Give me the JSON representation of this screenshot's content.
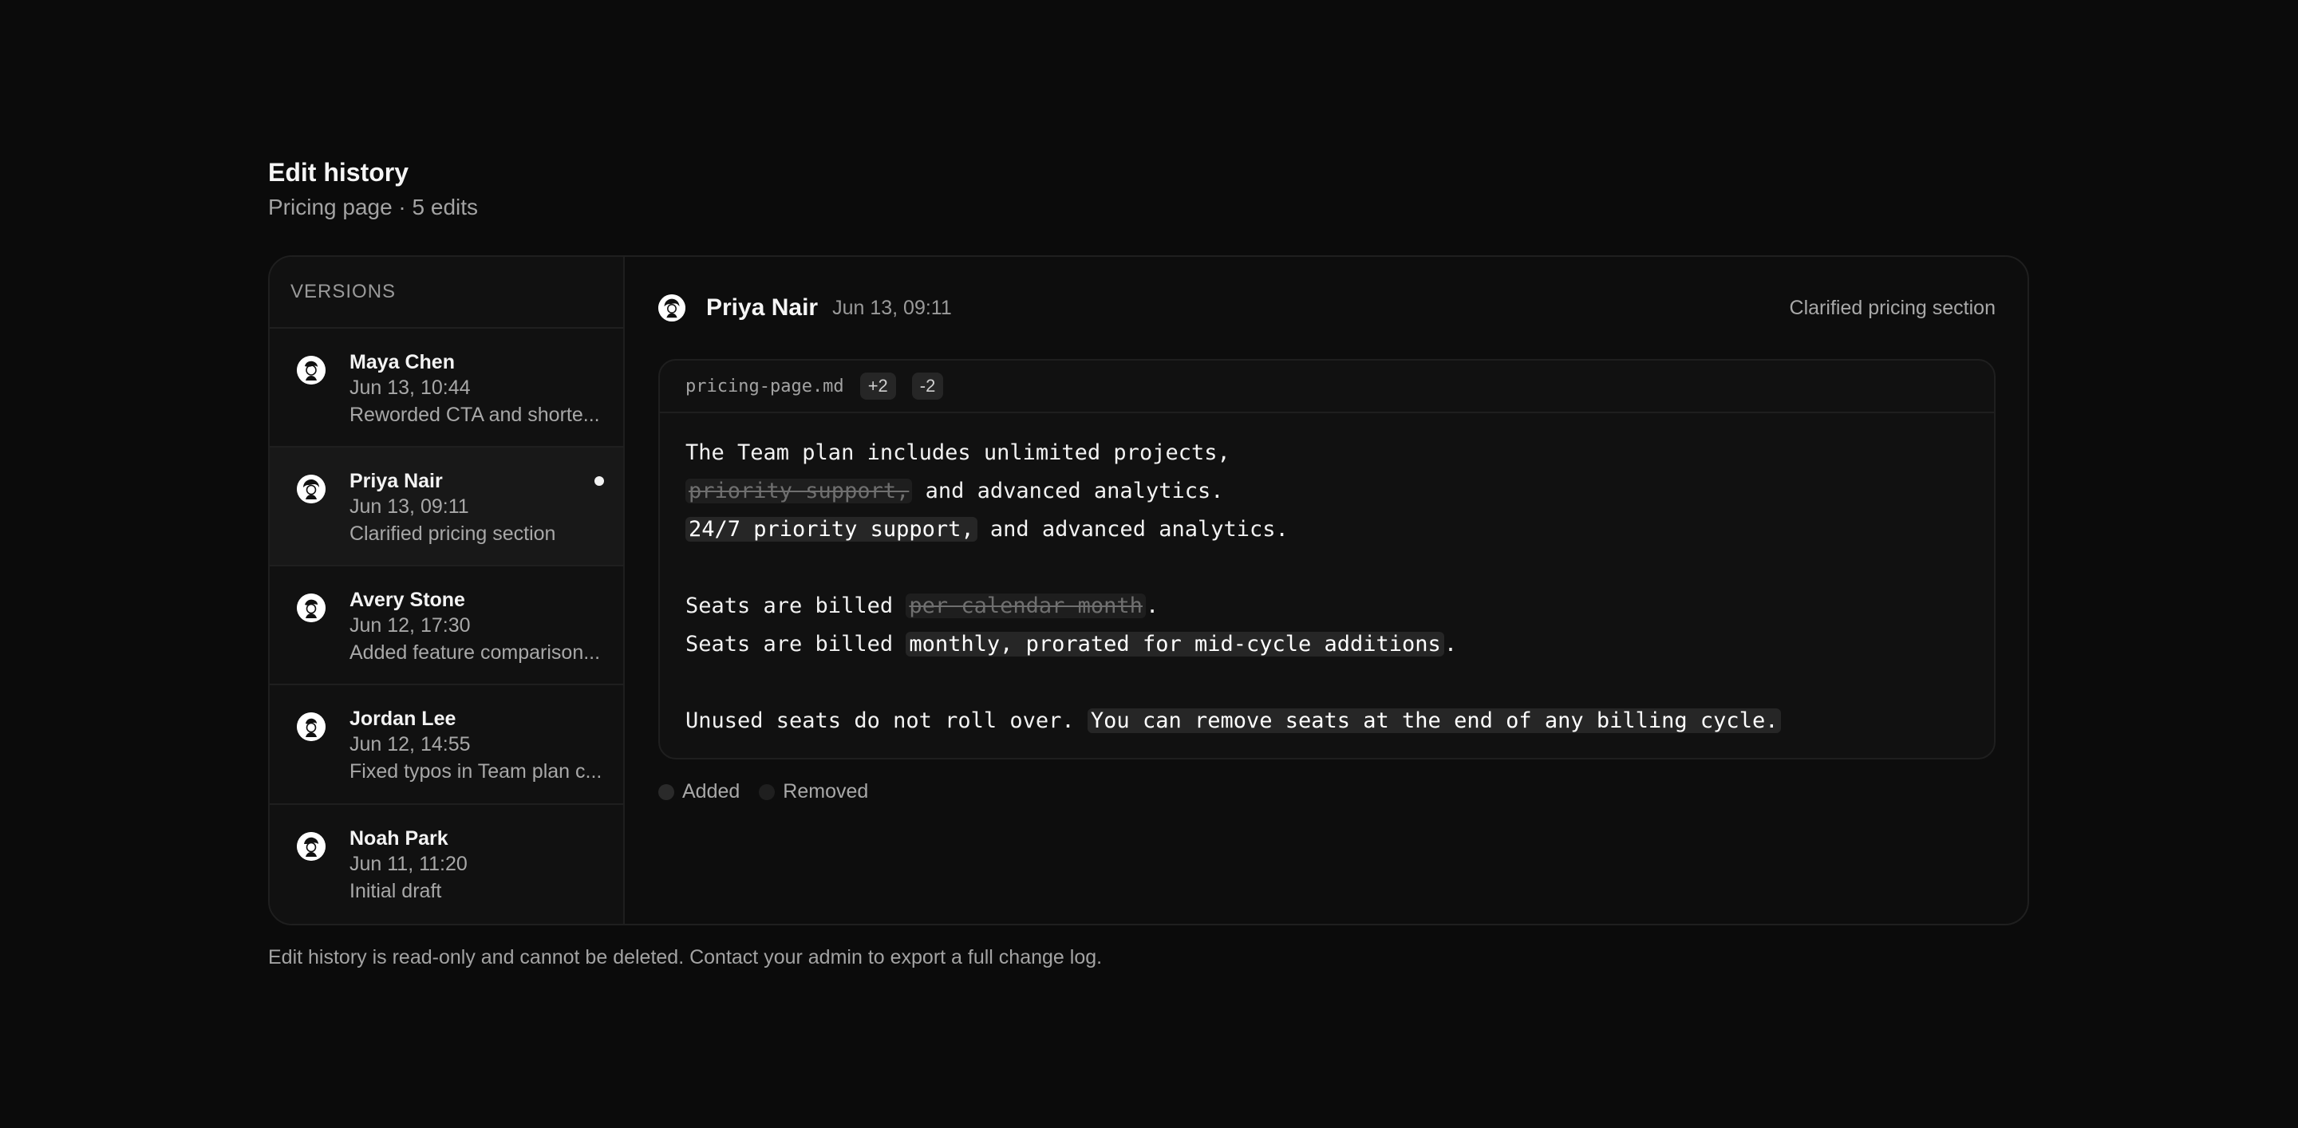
{
  "header": {
    "title": "Edit history",
    "subtitle": "Pricing page · 5 edits"
  },
  "sidebar": {
    "label": "VERSIONS",
    "versions": [
      {
        "name": "Maya Chen",
        "time": "Jun 13, 10:44",
        "desc": "Reworded CTA and shorte..."
      },
      {
        "name": "Priya Nair",
        "time": "Jun 13, 09:11",
        "desc": "Clarified pricing section"
      },
      {
        "name": "Avery Stone",
        "time": "Jun 12, 17:30",
        "desc": "Added feature comparison..."
      },
      {
        "name": "Jordan Lee",
        "time": "Jun 12, 14:55",
        "desc": "Fixed typos in Team plan c..."
      },
      {
        "name": "Noah Park",
        "time": "Jun 11, 11:20",
        "desc": "Initial draft"
      }
    ]
  },
  "detail": {
    "author": "Priya Nair",
    "time": "Jun 13, 09:11",
    "summary": "Clarified pricing section",
    "file": "pricing-page.md",
    "additions": "+2",
    "deletions": "-2",
    "lines": {
      "l1": "The Team plan includes unlimited projects,",
      "l2_removed": "priority support,",
      "l2_rest": " and advanced analytics.",
      "l3_added": "24/7 priority support,",
      "l3_rest": " and advanced analytics.",
      "l5_pre": "Seats are billed ",
      "l5_removed": "per calendar month",
      "l5_post": ".",
      "l6_pre": "Seats are billed ",
      "l6_added": "monthly, prorated for mid-cycle additions",
      "l6_post": ".",
      "l8_pre": "Unused seats do not roll over. ",
      "l8_added": "You can remove seats at the end of any billing cycle."
    }
  },
  "legend": {
    "added": "Added",
    "removed": "Removed"
  },
  "footer": "Edit history is read-only and cannot be deleted. Contact your admin to export a full change log."
}
